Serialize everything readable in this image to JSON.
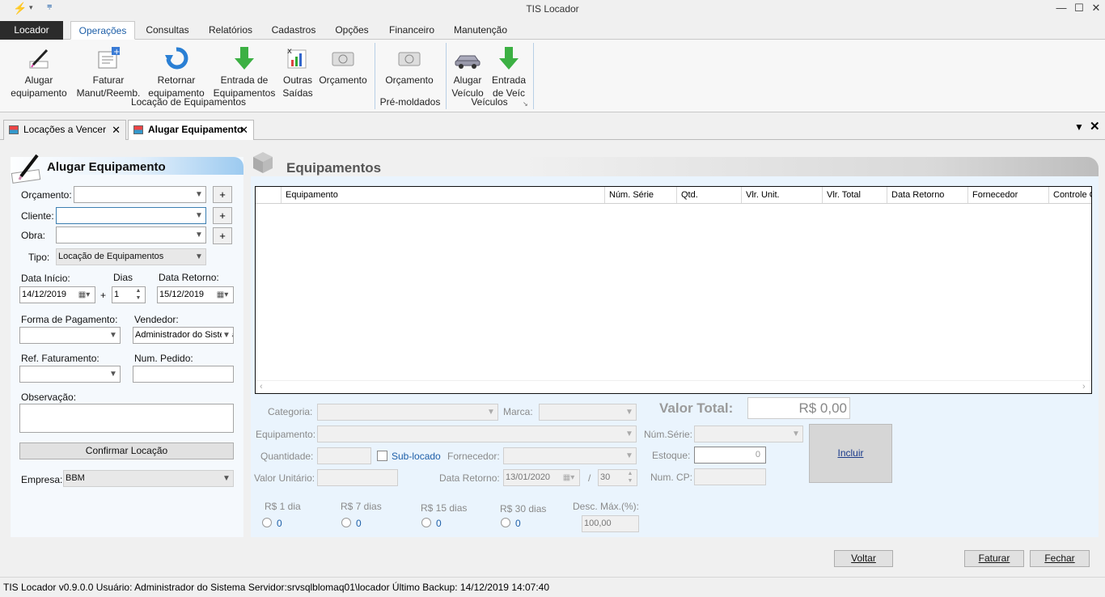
{
  "window": {
    "title": "TIS Locador",
    "minimize": "—",
    "maximize": "☐",
    "close": "✕"
  },
  "menu": [
    "Locador",
    "Operações",
    "Consultas",
    "Relatórios",
    "Cadastros",
    "Opções",
    "Financeiro",
    "Manutenção"
  ],
  "ribbon": {
    "buttons": [
      {
        "l1": "Alugar",
        "l2": "equipamento",
        "icon": "pen-icon"
      },
      {
        "l1": "Faturar",
        "l2": "Manut/Reemb.",
        "icon": "invoice-icon"
      },
      {
        "l1": "Retornar",
        "l2": "equipamento",
        "icon": "return-arrow-icon"
      },
      {
        "l1": "Entrada de",
        "l2": "Equipamentos",
        "icon": "green-down-arrow-icon"
      },
      {
        "l1": "Outras",
        "l2": "Saídas",
        "icon": "chart-icon"
      },
      {
        "l1": "Orçamento",
        "l2": "",
        "icon": "budget-icon"
      },
      {
        "l1": "Orçamento",
        "l2": "",
        "icon": "budget-icon"
      },
      {
        "l1": "Alugar",
        "l2": "Veículo",
        "icon": "car-icon"
      },
      {
        "l1": "Entrada",
        "l2": "de Veíc",
        "icon": "green-down-arrow-icon"
      }
    ],
    "groups": [
      "Locação de Equipamentos",
      "Pré-moldados",
      "Veículos"
    ]
  },
  "tabs": [
    {
      "label": "Locações a Vencer"
    },
    {
      "label": "Alugar Equipamento"
    }
  ],
  "left": {
    "title": "Alugar Equipamento",
    "orcamento_label": "Orçamento:",
    "cliente_label": "Cliente:",
    "obra_label": "Obra:",
    "tipo_label": "Tipo:",
    "tipo_value": "Locação de Equipamentos",
    "data_inicio_label": "Data Início:",
    "data_inicio_value": "14/12/2019",
    "dias_label": "Dias",
    "dias_value": "1",
    "plus_sign": "+",
    "data_retorno_label": "Data Retorno:",
    "data_retorno_value": "15/12/2019",
    "forma_pagamento_label": "Forma de Pagamento:",
    "vendedor_label": "Vendedor:",
    "vendedor_value": "Administrador do Sistema",
    "ref_faturamento_label": "Ref. Faturamento:",
    "num_pedido_label": "Num. Pedido:",
    "observacao_label": "Observação:",
    "confirmar_label": "Confirmar Locação",
    "empresa_label": "Empresa:",
    "empresa_value": "BBM"
  },
  "right": {
    "title": "Equipamentos",
    "columns": [
      "Equipamento",
      "Núm. Série",
      "Qtd.",
      "Vlr. Unit.",
      "Vlr. Total",
      "Data Retorno",
      "Fornecedor",
      "Controle C"
    ],
    "categoria_label": "Categoria:",
    "marca_label": "Marca:",
    "valor_total_label": "Valor Total:",
    "valor_total_value": "R$ 0,00",
    "equipamento_label": "Equipamento:",
    "num_serie_label": "Núm.Série:",
    "quantidade_label": "Quantidade:",
    "sublocado_label": "Sub-locado",
    "fornecedor_label": "Fornecedor:",
    "estoque_label": "Estoque:",
    "estoque_value": "0",
    "incluir_label": "Incluir",
    "valor_unitario_label": "Valor Unitário:",
    "data_retorno_label": "Data Retorno:",
    "data_retorno_value": "13/01/2020",
    "slash": "/",
    "dias_value": "30",
    "num_cp_label": "Num. CP:",
    "price_options": [
      {
        "label": "R$ 1 dia",
        "value": "0"
      },
      {
        "label": "R$ 7 dias",
        "value": "0"
      },
      {
        "label": "R$ 15 dias",
        "value": "0"
      },
      {
        "label": "R$ 30 dias",
        "value": "0"
      }
    ],
    "desc_max_label": "Desc. Máx.(%):",
    "desc_max_value": "100,00"
  },
  "footer": {
    "voltar": "Voltar",
    "faturar": "Faturar",
    "fechar": "Fechar"
  },
  "status": "TIS Locador v0.9.0.0  Usuário: Administrador do Sistema  Servidor:srvsqlblomaq01\\locador  Último Backup: 14/12/2019 14:07:40",
  "colors": {
    "accent": "#1e5fa8",
    "panel": "#eaf4fd",
    "header_blue": "#9ccaf0"
  }
}
